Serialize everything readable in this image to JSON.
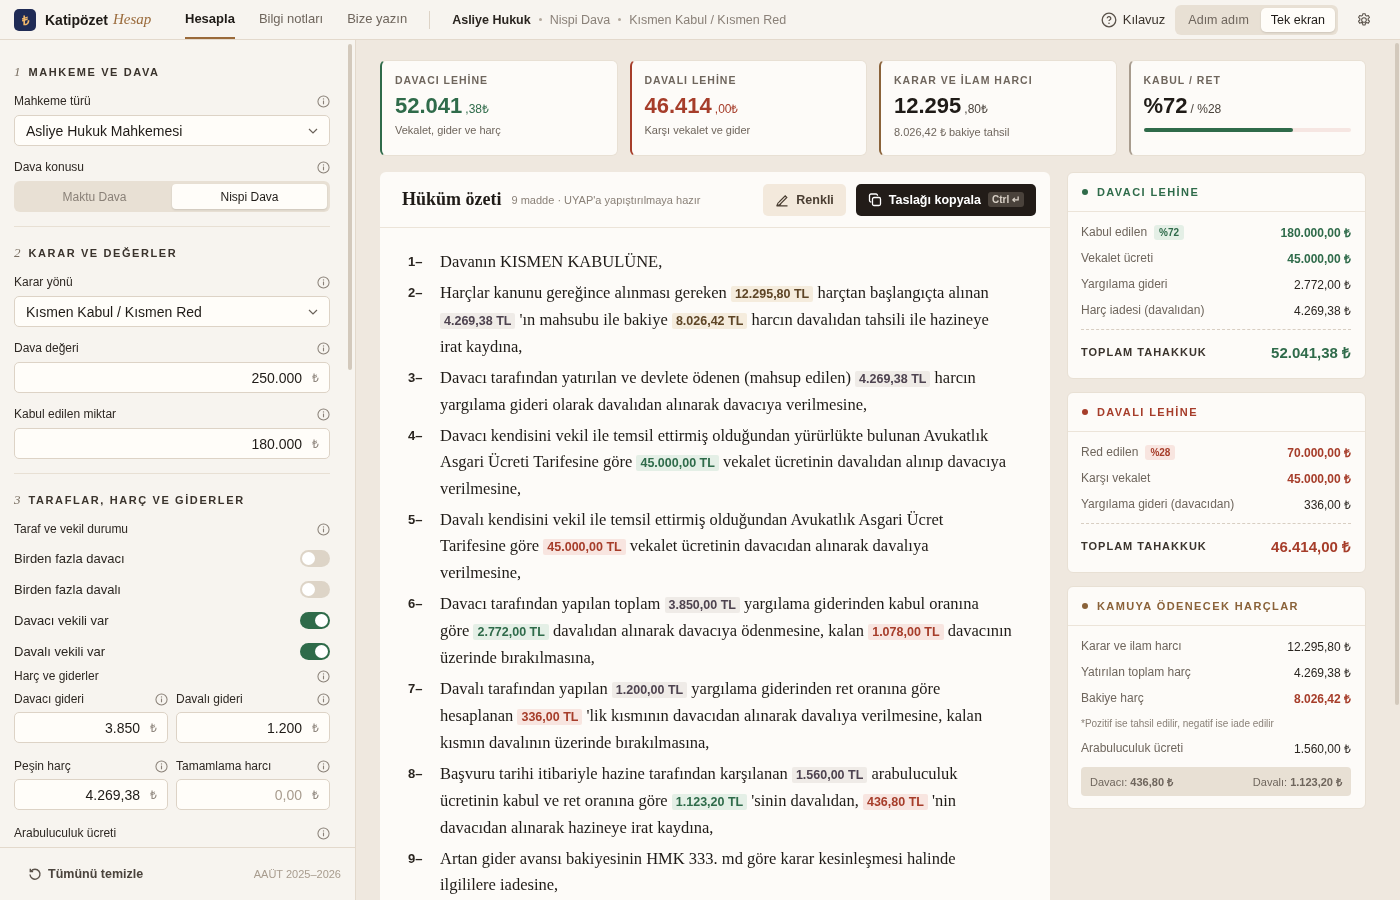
{
  "app": {
    "name": "Katipözet",
    "accent": "Hesap",
    "logo": "₺"
  },
  "nav": [
    {
      "label": "Hesapla",
      "selected": true
    },
    {
      "label": "Bilgi notları",
      "selected": false
    },
    {
      "label": "Bize yazın",
      "selected": false
    }
  ],
  "breadcrumb": [
    "Asliye Hukuk",
    "Nispi Dava",
    "Kısmen Kabul / Kısmen Red"
  ],
  "guide": "Kılavuz",
  "view_modes": [
    {
      "label": "Adım adım",
      "selected": false
    },
    {
      "label": "Tek ekran",
      "selected": true
    }
  ],
  "sidebar": {
    "sections": [
      {
        "number": "1",
        "title": "MAHKEME VE DAVA",
        "fields": [
          {
            "kind": "select",
            "label": "Mahkeme türü",
            "value": "Asliye Hukuk Mahkemesi"
          },
          {
            "kind": "segmented",
            "label": "Dava konusu",
            "options": [
              {
                "label": "Maktu Dava",
                "selected": false
              },
              {
                "label": "Nispi Dava",
                "selected": true
              }
            ]
          }
        ]
      },
      {
        "number": "2",
        "title": "KARAR VE DEĞERLER",
        "fields": [
          {
            "kind": "select",
            "label": "Karar yönü",
            "value": "Kısmen Kabul / Kısmen Red"
          },
          {
            "kind": "number",
            "label": "Dava değeri",
            "value": "250.000",
            "unit": "₺"
          },
          {
            "kind": "number",
            "label": "Kabul edilen miktar",
            "value": "180.000",
            "unit": "₺"
          }
        ]
      },
      {
        "number": "3",
        "title": "TARAFLAR, HARÇ VE GİDERLER",
        "fields": [
          {
            "kind": "heading",
            "label": "Taraf ve vekil durumu"
          },
          {
            "kind": "toggle",
            "label": "Birden fazla davacı",
            "on": false
          },
          {
            "kind": "toggle",
            "label": "Birden fazla davalı",
            "on": false
          },
          {
            "kind": "toggle",
            "label": "Davacı vekili var",
            "on": true
          },
          {
            "kind": "toggle",
            "label": "Davalı vekili var",
            "on": true
          },
          {
            "kind": "heading",
            "label": "Harç ve giderler"
          },
          {
            "kind": "pair",
            "items": [
              {
                "label": "Davacı gideri",
                "value": "3.850",
                "unit": "₺"
              },
              {
                "label": "Davalı gideri",
                "value": "1.200",
                "unit": "₺"
              }
            ]
          },
          {
            "kind": "pair",
            "items": [
              {
                "label": "Peşin harç",
                "value": "4.269,38",
                "unit": "₺"
              },
              {
                "label": "Tamamlama harcı",
                "placeholder": "0,00",
                "unit": "₺"
              }
            ]
          },
          {
            "kind": "heading",
            "label": "Arabuluculuk ücreti"
          }
        ]
      }
    ],
    "footer": {
      "reset": "Tümünü temizle",
      "version": "AAÜT 2025–2026"
    }
  },
  "kpis": [
    {
      "kind": "plaintiff",
      "label": "DAVACI LEHİNE",
      "value": "52.041",
      "decimals": ",38₺",
      "note": "Vekalet, gider ve harç"
    },
    {
      "kind": "defendant",
      "label": "DAVALI LEHİNE",
      "value": "46.414",
      "decimals": ",00₺",
      "note": "Karşı vekalet ve gider"
    },
    {
      "kind": "fee",
      "label": "KARAR VE İLAM HARCI",
      "value": "12.295",
      "decimals": ",80₺",
      "note": "8.026,42 ₺ bakiye tahsil"
    },
    {
      "kind": "ratio",
      "label": "KABUL / RET",
      "value": "%72",
      "decimals": "/ %28",
      "level": 0.72
    }
  ],
  "summary": {
    "title": "Hüküm özeti",
    "subtitle": "9 madde · UYAP'a yapıştırılmaya hazır",
    "color_button": "Renkli",
    "copy_button": "Taslağı kopyala",
    "shortcut": "Ctrl ↵",
    "clauses": [
      {
        "number": "1–",
        "parts": [
          {
            "kind": "text",
            "text": "Davanın KISMEN KABULÜNE,"
          }
        ]
      },
      {
        "number": "2–",
        "parts": [
          {
            "kind": "text",
            "text": "Harçlar kanunu gereğince alınması gereken "
          },
          {
            "kind": "fee",
            "text": "12.295,80 TL"
          },
          {
            "kind": "text",
            "text": " harçtan başlangıçta alınan "
          },
          {
            "kind": "paid",
            "text": "4.269,38 TL"
          },
          {
            "kind": "text",
            "text": " 'ın mahsubu ile bakiye "
          },
          {
            "kind": "fee",
            "text": "8.026,42 TL"
          },
          {
            "kind": "text",
            "text": " harcın davalıdan tahsili ile hazineye irat kaydına,"
          }
        ]
      },
      {
        "number": "3–",
        "parts": [
          {
            "kind": "text",
            "text": "Davacı tarafından yatırılan ve devlete ödenen (mahsup edilen) "
          },
          {
            "kind": "paid",
            "text": "4.269,38 TL"
          },
          {
            "kind": "text",
            "text": " harcın yargılama gideri olarak davalıdan alınarak davacıya verilmesine,"
          }
        ]
      },
      {
        "number": "4–",
        "parts": [
          {
            "kind": "text",
            "text": "Davacı kendisini vekil ile temsil ettirmiş olduğundan yürürlükte bulunan Avukatlık Asgari Ücreti Tarifesine göre "
          },
          {
            "kind": "plaintiff",
            "text": "45.000,00 TL"
          },
          {
            "kind": "text",
            "text": " vekalet ücretinin davalıdan alınıp davacıya verilmesine,"
          }
        ]
      },
      {
        "number": "5–",
        "parts": [
          {
            "kind": "text",
            "text": "Davalı kendisini vekil ile temsil ettirmiş olduğundan Avukatlık Asgari Ücret Tarifesine göre "
          },
          {
            "kind": "defendant",
            "text": "45.000,00 TL"
          },
          {
            "kind": "text",
            "text": " vekalet ücretinin davacıdan alınarak davalıya verilmesine,"
          }
        ]
      },
      {
        "number": "6–",
        "parts": [
          {
            "kind": "text",
            "text": "Davacı tarafından yapılan toplam "
          },
          {
            "kind": "paid",
            "text": "3.850,00 TL"
          },
          {
            "kind": "text",
            "text": " yargılama giderinden kabul oranına göre "
          },
          {
            "kind": "plaintiff",
            "text": "2.772,00 TL"
          },
          {
            "kind": "text",
            "text": " davalıdan alınarak davacıya ödenmesine, kalan "
          },
          {
            "kind": "defendant",
            "text": "1.078,00 TL"
          },
          {
            "kind": "text",
            "text": " davacının üzerinde bırakılmasına,"
          }
        ]
      },
      {
        "number": "7–",
        "parts": [
          {
            "kind": "text",
            "text": "Davalı tarafından yapılan "
          },
          {
            "kind": "paid",
            "text": "1.200,00 TL"
          },
          {
            "kind": "text",
            "text": " yargılama giderinden ret oranına göre hesaplanan "
          },
          {
            "kind": "defendant",
            "text": "336,00 TL"
          },
          {
            "kind": "text",
            "text": " 'lik kısmının davacıdan alınarak davalıya verilmesine, kalan kısmın davalının üzerinde bırakılmasına,"
          }
        ]
      },
      {
        "number": "8–",
        "parts": [
          {
            "kind": "text",
            "text": "Başvuru tarihi itibariyle hazine tarafından karşılanan "
          },
          {
            "kind": "paid",
            "text": "1.560,00 TL"
          },
          {
            "kind": "text",
            "text": " arabuluculuk ücretinin kabul ve ret oranına göre "
          },
          {
            "kind": "plaintiff",
            "text": "1.123,20 TL"
          },
          {
            "kind": "text",
            "text": " 'sinin davalıdan, "
          },
          {
            "kind": "defendant",
            "text": "436,80 TL"
          },
          {
            "kind": "text",
            "text": " 'nin davacıdan alınarak hazineye irat kaydına,"
          }
        ]
      },
      {
        "number": "9–",
        "parts": [
          {
            "kind": "text",
            "text": "Artan gider avansı bakiyesinin HMK 333. md göre karar kesinleşmesi halinde ilgililere iadesine,"
          }
        ]
      }
    ]
  },
  "panels": [
    {
      "kind": "plaintiff",
      "title": "DAVACI LEHİNE",
      "rows": [
        {
          "label": "Kabul edilen",
          "badge": "%72",
          "value": "180.000,00 ₺",
          "kind": "plaintiff"
        },
        {
          "label": "Vekalet ücreti",
          "value": "45.000,00 ₺",
          "kind": "plaintiff"
        },
        {
          "label": "Yargılama gideri",
          "value": "2.772,00 ₺",
          "kind": "normal"
        },
        {
          "label": "Harç iadesi (davalıdan)",
          "value": "4.269,38 ₺",
          "kind": "normal"
        }
      ],
      "total": {
        "label": "TOPLAM TAHAKKUK",
        "value": "52.041,38 ₺"
      }
    },
    {
      "kind": "defendant",
      "title": "DAVALI LEHİNE",
      "rows": [
        {
          "label": "Red edilen",
          "badge": "%28",
          "value": "70.000,00 ₺",
          "kind": "defendant"
        },
        {
          "label": "Karşı vekalet",
          "value": "45.000,00 ₺",
          "kind": "defendant"
        },
        {
          "label": "Yargılama gideri (davacıdan)",
          "value": "336,00 ₺",
          "kind": "normal"
        }
      ],
      "total": {
        "label": "TOPLAM TAHAKKUK",
        "value": "46.414,00 ₺"
      }
    },
    {
      "kind": "fee",
      "title": "KAMUYA ÖDENECEK HARÇLAR",
      "rows": [
        {
          "label": "Karar ve ilam harcı",
          "value": "12.295,80 ₺",
          "kind": "normal"
        },
        {
          "label": "Yatırılan toplam harç",
          "value": "4.269,38 ₺",
          "kind": "normal"
        },
        {
          "label": "Bakiye harç",
          "value": "8.026,42 ₺",
          "kind": "defendant"
        }
      ],
      "note": "*Pozitif ise tahsil edilir, negatif ise iade edilir",
      "extra_rows": [
        {
          "label": "Arabuluculuk ücreti",
          "value": "1.560,00 ₺",
          "kind": "normal"
        }
      ],
      "split": [
        "Davacı: **436,80 ₺**",
        "Davalı: **1.123,20 ₺**"
      ]
    }
  ]
}
